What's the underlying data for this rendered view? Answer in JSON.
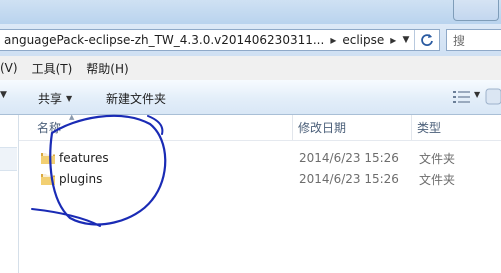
{
  "address": {
    "crumbs": [
      "anguagePack-eclipse-zh_TW_4.3.0.v201406230311...",
      "eclipse"
    ],
    "separator": "▸",
    "search_placeholder": "搜"
  },
  "menu": [
    "(V)",
    "工具(T)",
    "帮助(H)"
  ],
  "toolbar": {
    "share_label": "共享",
    "new_folder_label": "新建文件夹"
  },
  "columns": {
    "name": "名称",
    "date": "修改日期",
    "type": "类型"
  },
  "files": [
    {
      "name": "features",
      "date": "2014/6/23 15:26",
      "type": "文件夹"
    },
    {
      "name": "plugins",
      "date": "2014/6/23 15:26",
      "type": "文件夹"
    }
  ],
  "colors": {
    "annotation": "#1a2bb5",
    "folder": "#e9c46a"
  }
}
